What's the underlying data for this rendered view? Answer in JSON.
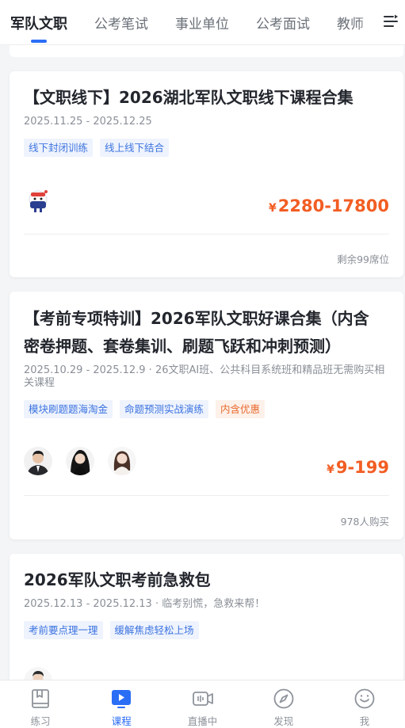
{
  "tabs": [
    {
      "label": "军队文职",
      "active": true
    },
    {
      "label": "公考笔试"
    },
    {
      "label": "事业单位"
    },
    {
      "label": "公考面试"
    },
    {
      "label": "教师"
    }
  ],
  "menu_icon": "menu-lines-icon",
  "cards": [
    {
      "title": "【文职线下】2026湖北军队文职线下课程合集",
      "subtitle": "2025.11.25 - 2025.12.25",
      "tags": [
        "线下封闭训练",
        "线上线下结合"
      ],
      "price_symbol": "¥",
      "price": "2280-17800",
      "footnote": "剩余99席位"
    },
    {
      "title_line1": "【考前专项特训】2026军队文职好课合集（内含",
      "title_line2": "密卷押题、套卷集训、刷题飞跃和冲刺预测）",
      "subtitle": "2025.10.29 - 2025.12.9 · 26文职AI班、公共科目系统班和精品班无需购买相关课程",
      "tags": [
        "模块刷题题海淘金",
        "命题预测实战演练",
        "内含优惠"
      ],
      "price_symbol": "¥",
      "price": "9-199",
      "footnote": "978人购买"
    },
    {
      "title": "2026军队文职考前急救包",
      "subtitle": "2025.12.13 - 2025.12.13 · 临考别慌，急救来帮！",
      "tags": [
        "考前要点理一理",
        "缓解焦虑轻松上场"
      ]
    }
  ],
  "bottom_nav": [
    {
      "label": "练习",
      "icon": "book-icon"
    },
    {
      "label": "课程",
      "icon": "play-icon",
      "active": true
    },
    {
      "label": "直播中",
      "icon": "live-camera-icon"
    },
    {
      "label": "发现",
      "icon": "compass-icon"
    },
    {
      "label": "我",
      "icon": "smile-icon"
    }
  ],
  "colors": {
    "accent": "#2b6ef6",
    "price": "#f25d23",
    "tag_blue": "#3d74e0",
    "tag_orange": "#e9692d"
  }
}
